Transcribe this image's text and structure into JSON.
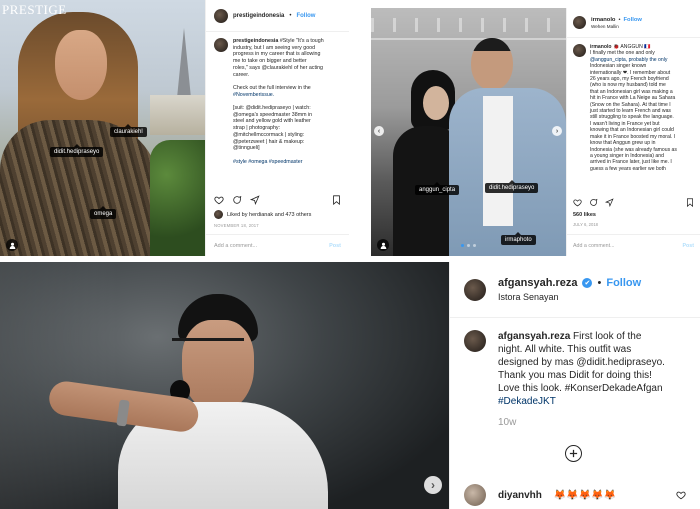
{
  "post1": {
    "brand": "PRESTIGE",
    "username": "prestigeindonesia",
    "separator": "•",
    "follow": "Follow",
    "caption_user": "prestigeindonesia",
    "caption_lines": [
      "#Style \"It's a tough",
      "industry, but I am seeing very good",
      "progress in my career that is allowing",
      "me to take on bigger and better",
      "roles,\" says @claurakiehl of her acting",
      "career.",
      "",
      "Check out the full interview in the",
      "#Novemberissue.",
      "",
      "[suit: @didit.hedipraseyo | watch:",
      "@omega's speedmaster 38mm in",
      "steel and yellow gold with leather",
      "strap | photography:",
      "@mitchellmccormack | styling:",
      "@peterzweet | hair & makeup:",
      "@tinngueli]",
      "",
      "#style #omega #speedmaster"
    ],
    "likes": "Liked by herdianak and 473 others",
    "date": "NOVEMBER 18, 2017",
    "add_comment": "Add a comment...",
    "post_btn": "Post",
    "tags": [
      "claurakiehl",
      "didit.hedipraseyo",
      "omega"
    ]
  },
  "post2": {
    "username": "irmanolo",
    "separator": "•",
    "follow": "Follow",
    "location": "Wehen Mallin",
    "caption_user": "irmanolo",
    "caption_lines": [
      "I finally met the one and only",
      "@anggun_cipta, probably the only",
      "Indonesian singer known",
      "internationally ❤. I remember about",
      "26 years ago, my French boyfriend",
      "(who is now my husband) told me",
      "that an Indonesian girl was making a",
      "hit in France with La Neige au Sahara",
      "(Snow on the Sahara). At that time I",
      "just started to learn French and was",
      "still struggling to speak the language.",
      "I wasn't living in France yet but",
      "knowing that an Indonesian girl could",
      "make it in France boosted my moral. I",
      "know that Anggun grew up in",
      "Indonesia (she was already famous as",
      "a young singer in Indonesia) and",
      "arrived in France later, just like me. I",
      "guess a few years earlier we both"
    ],
    "caption_head": "🐞 ANGGUN 🇫🇷",
    "likes": "560 likes",
    "date": "JULY 6, 2018",
    "add_comment": "Add a comment...",
    "post_btn": "Post",
    "tags": [
      "anggun_cipta",
      "didit.hedipraseyo",
      "irmaphoto"
    ]
  },
  "post3": {
    "username": "afgansyah.reza",
    "verified": "✔",
    "separator": "•",
    "follow": "Follow",
    "location": "Istora Senayan",
    "caption_user": "afgansyah.reza",
    "caption_lines": [
      "First look of the",
      "night. All white. This outfit was",
      "designed by mas @didit.hedipraseyo.",
      "Thank you mas Didit for doing this!",
      "Love this look. #KonserDekadeAfgan",
      "#DekadeJKT"
    ],
    "age": "10w",
    "comment_user": "diyanvhh",
    "comment_text": "🦊🦊🦊🦊🦊",
    "colors": {
      "link": "#003569",
      "follow": "#3897f0"
    }
  }
}
